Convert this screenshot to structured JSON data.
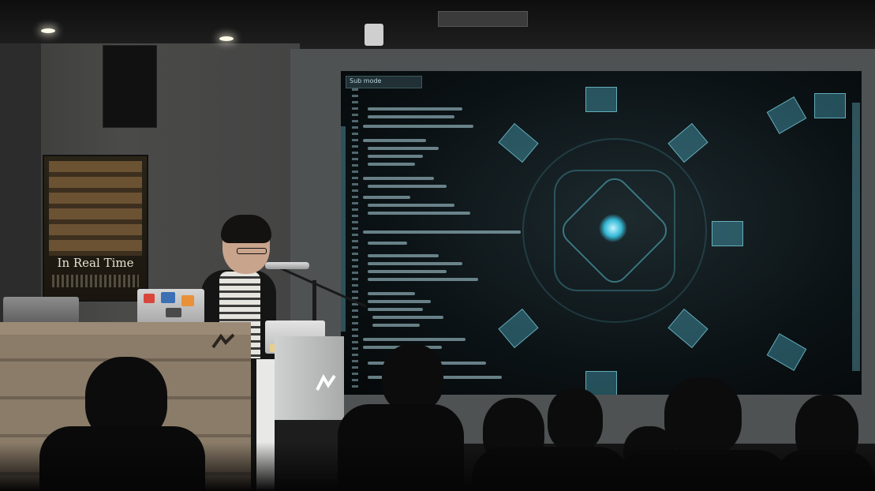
{
  "scene": {
    "description_kind": "photo",
    "poster": {
      "title": "In Real Time"
    },
    "projection": {
      "toolbar_label": "Sub mode"
    }
  },
  "colors": {
    "projection_accent": "#5fd3ea",
    "wall": "#454543",
    "desk_wood": "#8b7c69"
  }
}
